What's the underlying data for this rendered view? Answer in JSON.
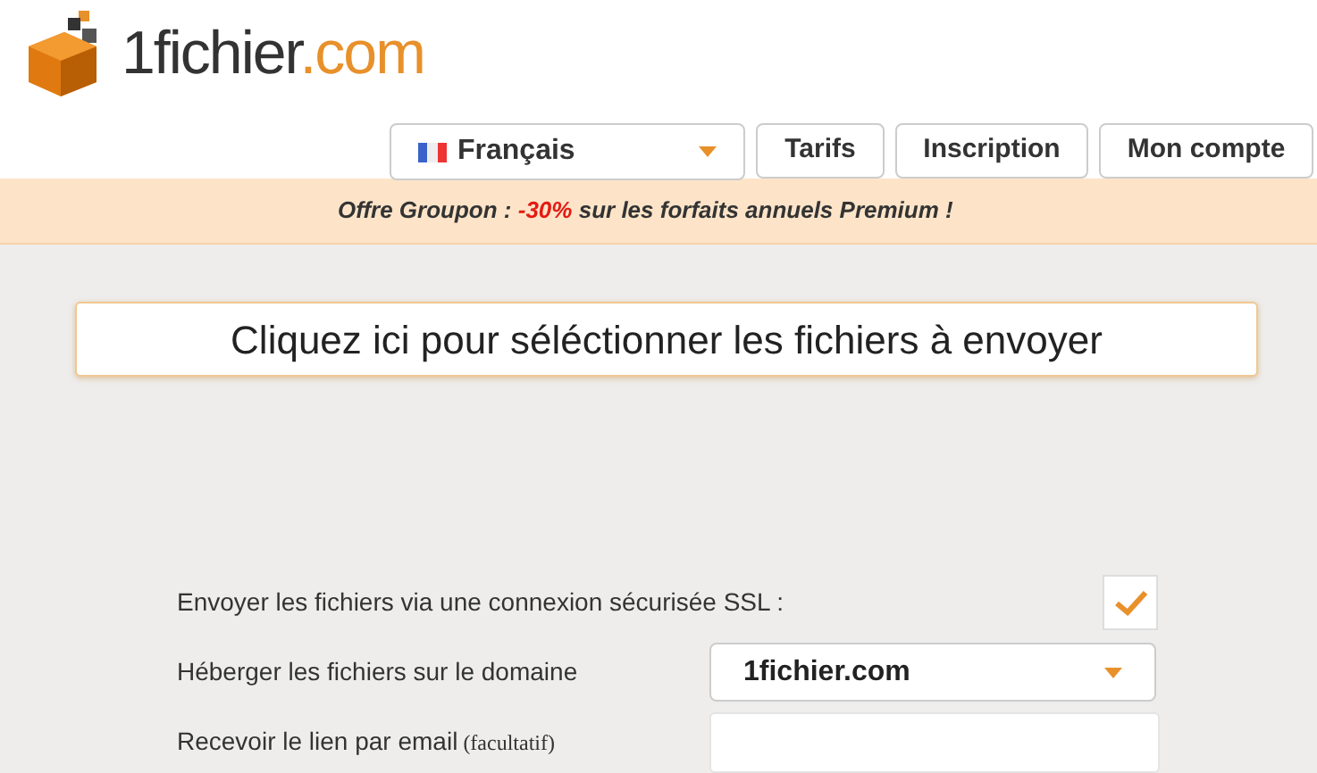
{
  "logo": {
    "name": "1fichier",
    "suffix": ".com"
  },
  "nav": {
    "language": {
      "label": "Français"
    },
    "buttons": [
      "Tarifs",
      "Inscription",
      "Mon compte"
    ]
  },
  "promo": {
    "prefix": "Offre Groupon : ",
    "highlight": "-30%",
    "suffix": " sur les forfaits annuels Premium !"
  },
  "upload_button": "Cliquez ici pour séléctionner les fichiers à envoyer",
  "form": [
    {
      "kind": "checkbox",
      "label": "Envoyer les fichiers via une connexion sécurisée SSL :",
      "checked": true
    },
    {
      "kind": "select",
      "label": "Héberger les fichiers sur le domaine",
      "value": "1fichier.com"
    },
    {
      "kind": "input",
      "label": "Recevoir le lien par email",
      "note": "(facultatif)"
    }
  ]
}
